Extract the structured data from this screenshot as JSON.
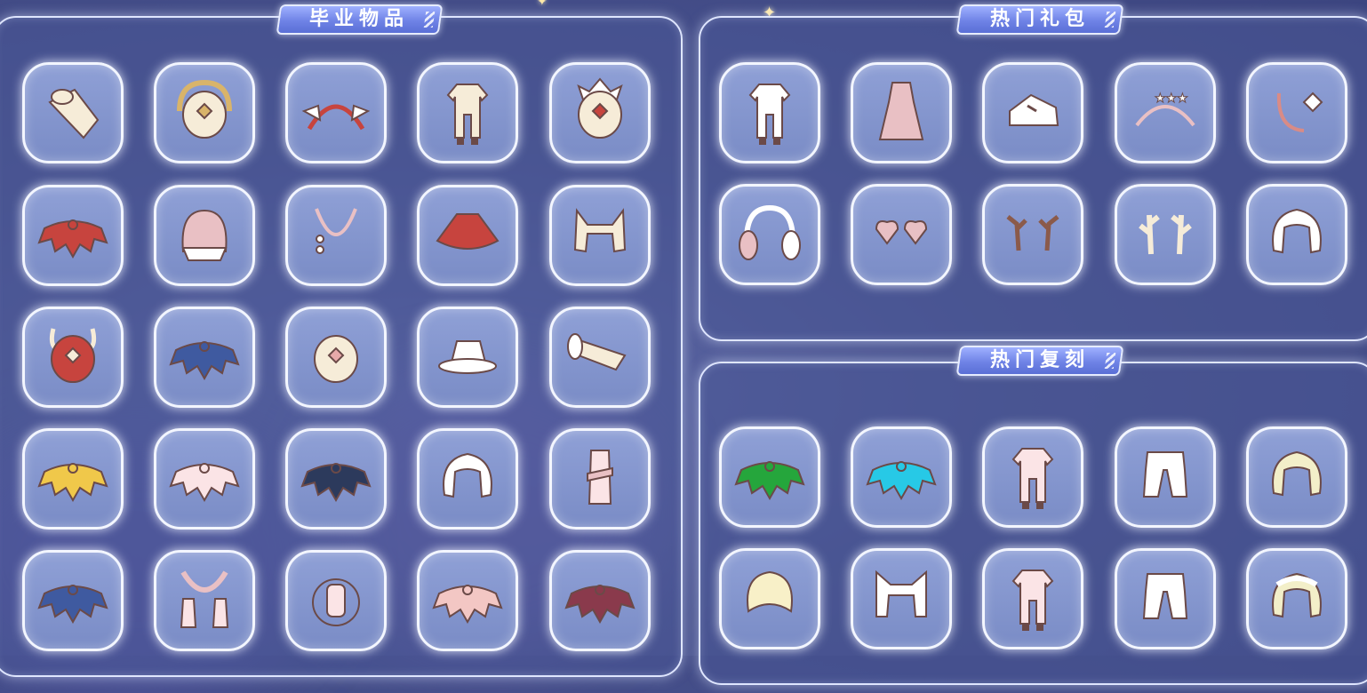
{
  "sections": {
    "graduation": {
      "title": "毕业物品"
    },
    "hot_gift": {
      "title": "热门礼包"
    },
    "hot_rerun": {
      "title": "热门复刻"
    }
  },
  "graduation_items": [
    "drum-icon",
    "sun-mask-icon",
    "wing-headband-icon",
    "outfit-icon",
    "feather-mask-icon",
    "red-cape-icon",
    "hood-mask-icon",
    "necklace-icon",
    "red-cloak-icon",
    "fox-ears-hair-icon",
    "horned-mask-icon",
    "blue-cape-icon",
    "round-mask-icon",
    "hat-icon",
    "horn-instrument-icon",
    "yellow-cape-icon",
    "pink-cape-icon",
    "dark-cape-icon",
    "hood-hair-icon",
    "scarf-outfit-icon",
    "blue-cape-icon",
    "pink-scarf-icon",
    "hourglass-prop-icon",
    "pink-shell-cape-icon",
    "maroon-cape-icon"
  ],
  "gift_items": [
    "robe-icon",
    "pink-dress-icon",
    "shoes-icon",
    "star-moon-headband-icon",
    "earring-icon",
    "earmuffs-icon",
    "heart-glasses-icon",
    "antlers-icon",
    "coral-horns-icon",
    "bob-hair-icon"
  ],
  "rerun_items": [
    "green-cape-icon",
    "cyan-cape-icon",
    "pink-outfit-icon",
    "pants-icon",
    "curly-hair-icon",
    "short-hair-icon",
    "cat-ears-hair-icon",
    "pink-outfit-icon",
    "cargo-pants-icon",
    "flower-crown-hair-icon"
  ],
  "colors": {
    "cream": "#f6ecd8",
    "outline": "#6b4a48",
    "red": "#c7443e",
    "blue": "#3f5aa0",
    "pink": "#e9c0c4",
    "yellow": "#f0c84a",
    "green": "#25a63c",
    "cyan": "#27c9e6",
    "maroon": "#8a3a4c",
    "navy": "#2c3a5c",
    "skyblue": "#8fd0e8"
  }
}
